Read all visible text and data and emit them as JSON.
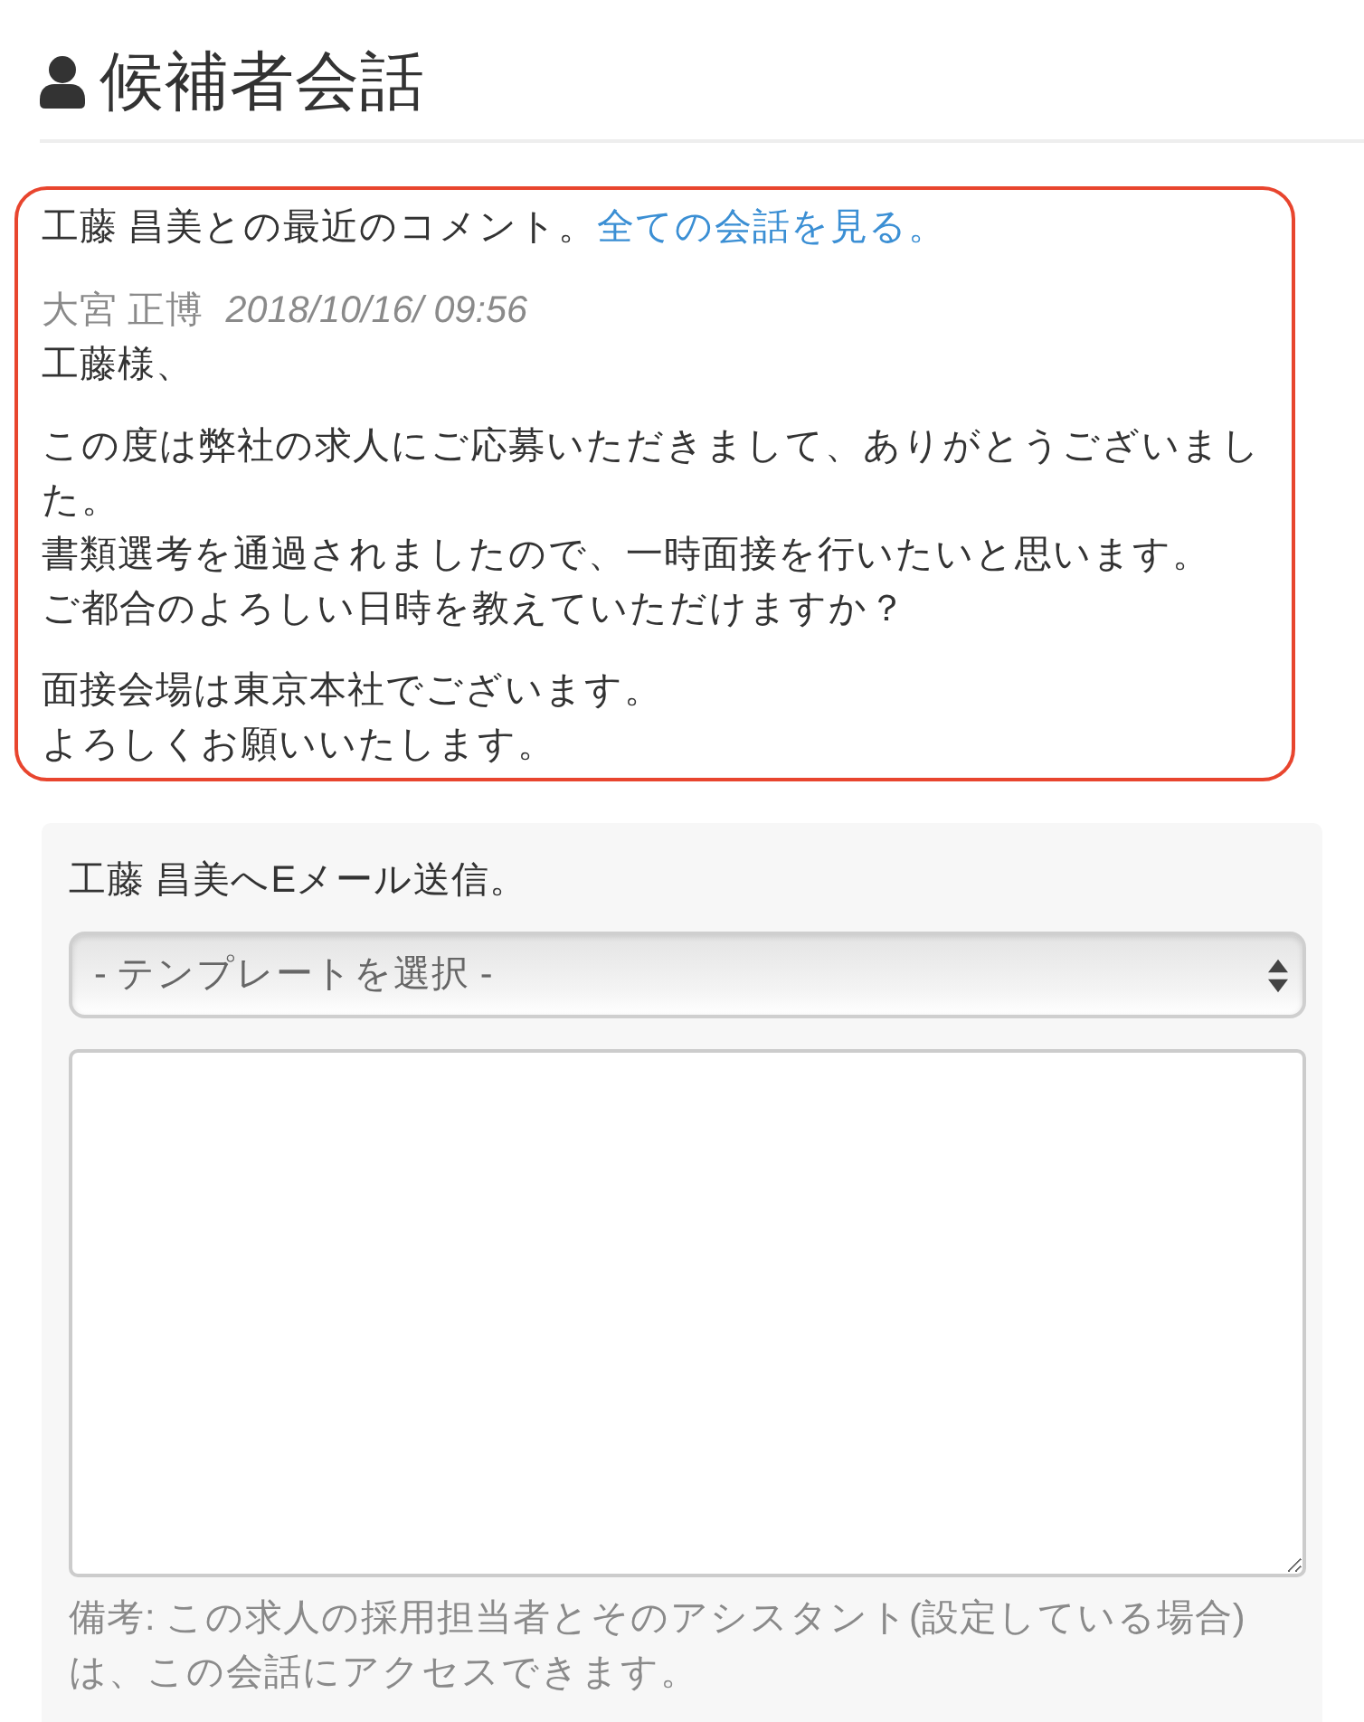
{
  "header": {
    "title": "候補者会話"
  },
  "recent_comments": {
    "highlighted": true,
    "intro": "工藤 昌美との最近のコメント。",
    "link": "全ての会話を見る。",
    "comment": {
      "author": "大宮 正博",
      "timestamp": "2018/10/16/ 09:56",
      "paragraphs": [
        [
          "工藤様、"
        ],
        [
          "この度は弊社の求人にご応募いただきまして、ありがとうございました。",
          "書類選考を通過されましたので、一時面接を行いたいと思います。",
          "ご都合のよろしい日時を教えていただけますか？"
        ],
        [
          "面接会場は東京本社でございます。",
          "よろしくお願いいたします。"
        ]
      ]
    }
  },
  "email_form": {
    "label": "工藤 昌美へEメール送信。",
    "template_select": {
      "placeholder": "- テンプレートを選択 -"
    },
    "note": "備考: この求人の採用担当者とそのアシスタント(設定している場合)は、この会話にアクセスできます。"
  }
}
